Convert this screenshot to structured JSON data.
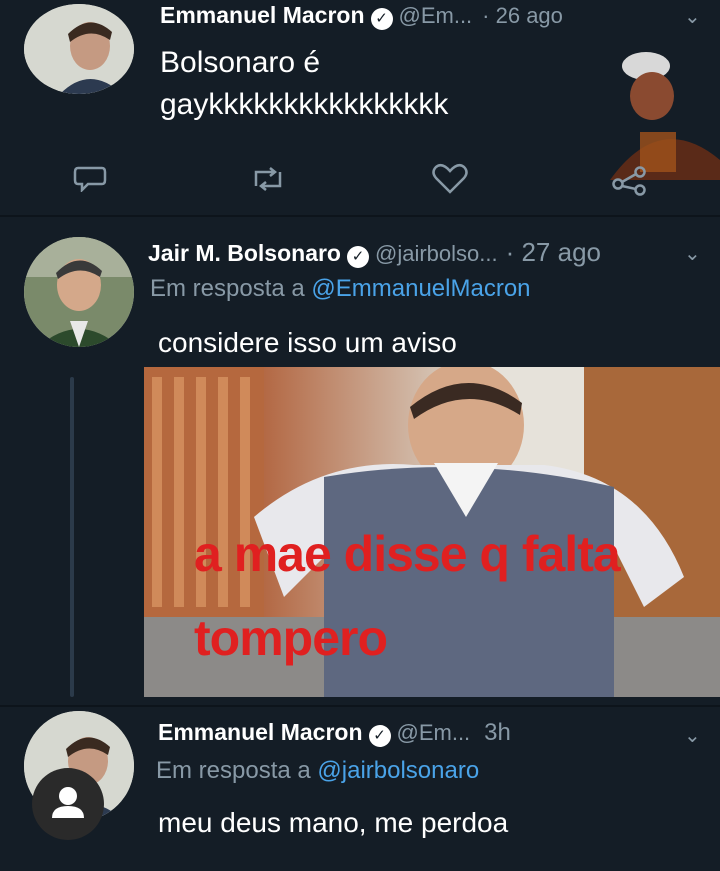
{
  "tweets": [
    {
      "name": "Emmanuel Macron",
      "handle": "@Em...",
      "time": "· 26 ago",
      "text_lines": [
        "Bolsonaro é",
        "gaykkkkkkkkkkkkkkkk"
      ]
    },
    {
      "name": "Jair M. Bolsonaro",
      "handle": "@jairbolso...",
      "time": "· 27 ago",
      "reply_prefix": "Em resposta a",
      "reply_mention": "@EmmanuelMacron",
      "text": "considere isso um aviso",
      "media_caption_line1": "a mae disse q falta",
      "media_caption_line2": "tompero"
    },
    {
      "name": "Emmanuel Macron",
      "handle": "@Em...",
      "time": "3h",
      "reply_prefix": "Em resposta a",
      "reply_mention": "@jairbolsonaro",
      "text": "meu deus mano, me perdoa"
    }
  ],
  "icons": {
    "reply": "speech-bubble-icon",
    "retweet": "retweet-icon",
    "like": "heart-icon",
    "share": "share-icon",
    "caret": "chevron-down-icon",
    "verified": "verified-badge-icon",
    "profile": "person-icon"
  },
  "colors": {
    "background": "#141d26",
    "muted": "#8899a6",
    "link": "#4aa3e8",
    "caption": "#e02020"
  }
}
